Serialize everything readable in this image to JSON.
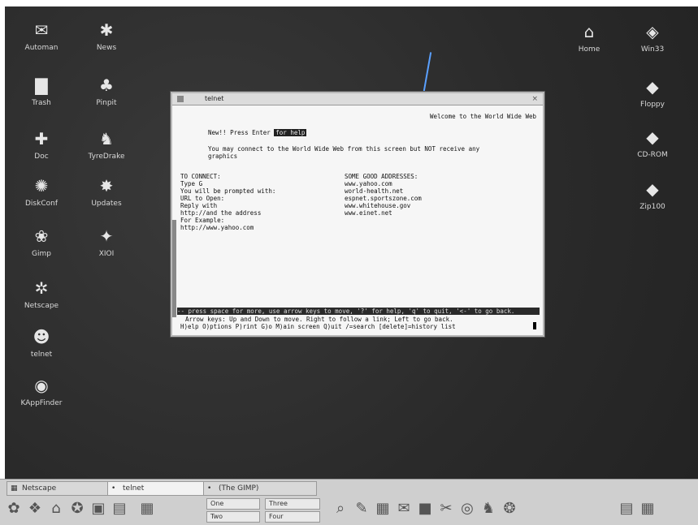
{
  "desktop": {
    "icons_left": [
      {
        "label": "Automan",
        "icon": "mailbox-icon"
      },
      {
        "label": "News",
        "icon": "news-icon"
      },
      {
        "label": "Trash",
        "icon": "trash-icon"
      },
      {
        "label": "Pinpit",
        "icon": "pinpit-icon"
      },
      {
        "label": "Doc",
        "icon": "doc-icon"
      },
      {
        "label": "TyreDrake",
        "icon": "tyredrake-icon"
      },
      {
        "label": "DiskConf",
        "icon": "diskconf-icon"
      },
      {
        "label": "Updates",
        "icon": "updates-icon"
      },
      {
        "label": "Gimp",
        "icon": "gimp-icon"
      },
      {
        "label": "XIOI",
        "icon": "xioi-icon"
      },
      {
        "label": "Netscape",
        "icon": "netscape-icon"
      },
      {
        "label": "telnet",
        "icon": "telnet-icon"
      },
      {
        "label": "KAppFinder",
        "icon": "kappfinder-icon"
      }
    ],
    "icons_right": [
      {
        "label": "Home",
        "icon": "home-icon"
      },
      {
        "label": "Win33",
        "icon": "win33-icon"
      },
      {
        "label": "Floppy",
        "icon": "floppy-icon"
      },
      {
        "label": "CD-ROM",
        "icon": "cdrom-icon"
      },
      {
        "label": "Zip100",
        "icon": "zip-icon"
      }
    ]
  },
  "telnet": {
    "title": "telnet",
    "welcome": "Welcome to the World Wide Web",
    "press_line": "New!! Press Enter",
    "press_hl": "for help",
    "connect_line1": "You may connect to the World Wide Web from this screen but NOT receive any",
    "connect_line2": "graphics",
    "to_connect_header": "TO CONNECT:",
    "to_connect_lines": [
      "Type G",
      "You will be prompted with:",
      "URL to Open:",
      "Reply with",
      "http://and the address",
      "For Example:",
      "http://www.yahoo.com"
    ],
    "addresses_header": "SOME GOOD ADDRESSES:",
    "addresses": [
      "www.yahoo.com",
      "world-health.net",
      "espnet.sportszone.com",
      "www.whitehouse.gov",
      "www.einet.net"
    ],
    "status_bar": "-- press space for more, use arrow keys to move, '?' for help, 'q' to quit, '<-' to go back.",
    "help_line1": "Arrow keys: Up and Down to move. Right to follow a link; Left to go back.",
    "help_line2": "H)elp O)ptions P)rint G)o M)ain screen Q)uit /=search [delete]=history list"
  },
  "taskbar": {
    "tasks": [
      {
        "label": "Netscape"
      },
      {
        "label": "telnet"
      },
      {
        "label": "(The GIMP)"
      }
    ],
    "desk_one": "One",
    "desk_two": "Two",
    "desk_three": "Three",
    "desk_four": "Four"
  }
}
